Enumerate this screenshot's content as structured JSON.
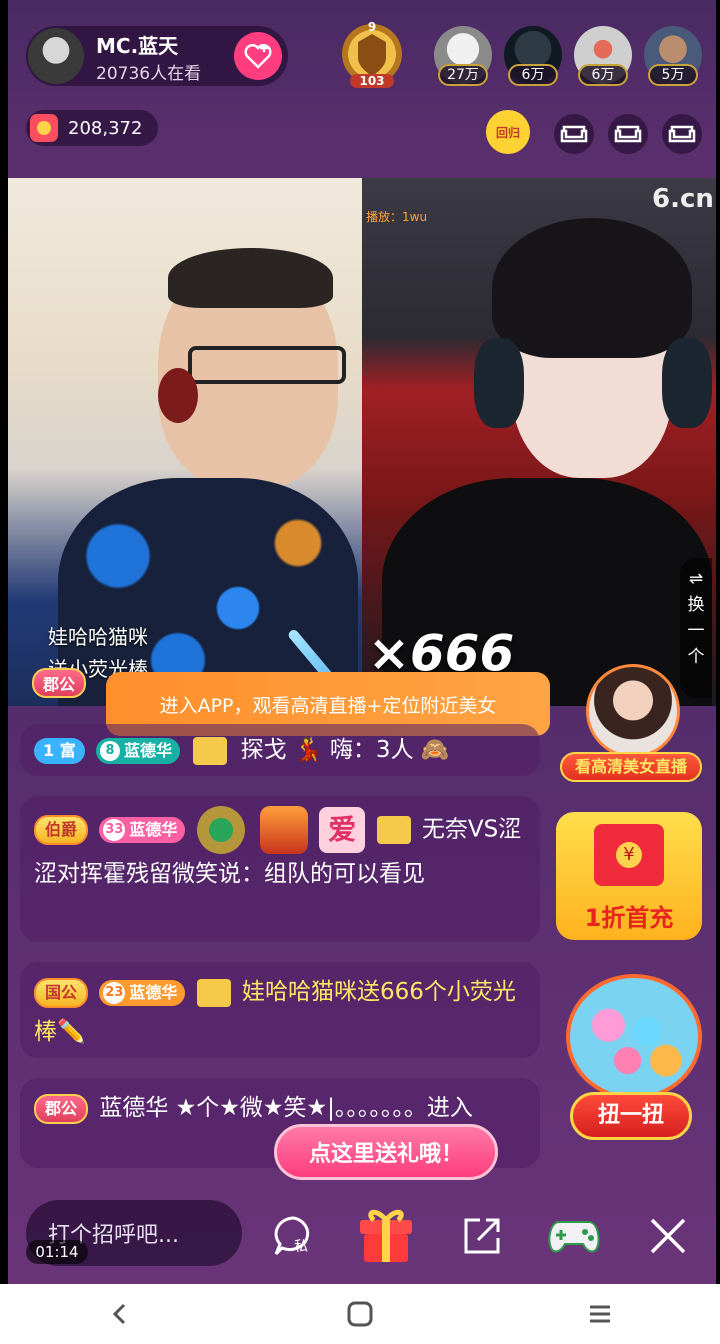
{
  "header": {
    "host_name": "MC.蓝天",
    "viewers": "20736人在看",
    "badge_level": "103",
    "badge_top": "9",
    "fans": [
      {
        "count": "27万"
      },
      {
        "count": "6万"
      },
      {
        "count": "6万"
      },
      {
        "count": "5万"
      }
    ],
    "coins": "208,372",
    "return_badge": "回归"
  },
  "video": {
    "watermark": "6.cn",
    "left_caption_name": "娃哈哈猫咪",
    "left_caption_gift": "送小荧光棒",
    "left_tag": "郡公",
    "right_small_label": "播放：1wu",
    "multiplier": "×666",
    "swap_label": "⇌ 换 一 个"
  },
  "app_banner": "进入APP，观看高清直播+定位附近美女",
  "side_promos": {
    "beauty_live": "看高清美女直播",
    "first_charge": "1折首充",
    "twist": "扭一扭"
  },
  "chat": [
    {
      "tags": [
        {
          "text": "1 富",
          "kind": "fu"
        },
        {
          "text": "8",
          "kind": "level"
        }
      ],
      "name": "蓝德华",
      "text": "探戈 💃 嗨：3人 🙈"
    },
    {
      "tags": [
        {
          "text": "伯爵",
          "kind": "title"
        },
        {
          "text": "33",
          "kind": "level"
        }
      ],
      "name": "蓝德华",
      "extra_icon": "爱",
      "text": "无奈VS涩涩对挥霍残留微笑说：组队的可以看见"
    },
    {
      "tags": [
        {
          "text": "国公",
          "kind": "title"
        },
        {
          "text": "23",
          "kind": "level"
        }
      ],
      "name": "蓝德华",
      "text_user": "娃哈哈猫咪",
      "text": "送666个小荧光棒✏️"
    },
    {
      "tags": [
        {
          "text": "郡公",
          "kind": "title"
        }
      ],
      "name": "蓝德华",
      "text": "★个★微★笑★|。。。。。。。进入"
    }
  ],
  "gift_tip": "点这里送礼哦！",
  "bottom_bar": {
    "input_placeholder": "打个招呼吧...",
    "time": "01:14",
    "private_label": "私"
  },
  "colors": {
    "accent_pink": "#ff3d7f",
    "gold": "#f5c94a",
    "banner_orange": "#ff9a2e"
  }
}
